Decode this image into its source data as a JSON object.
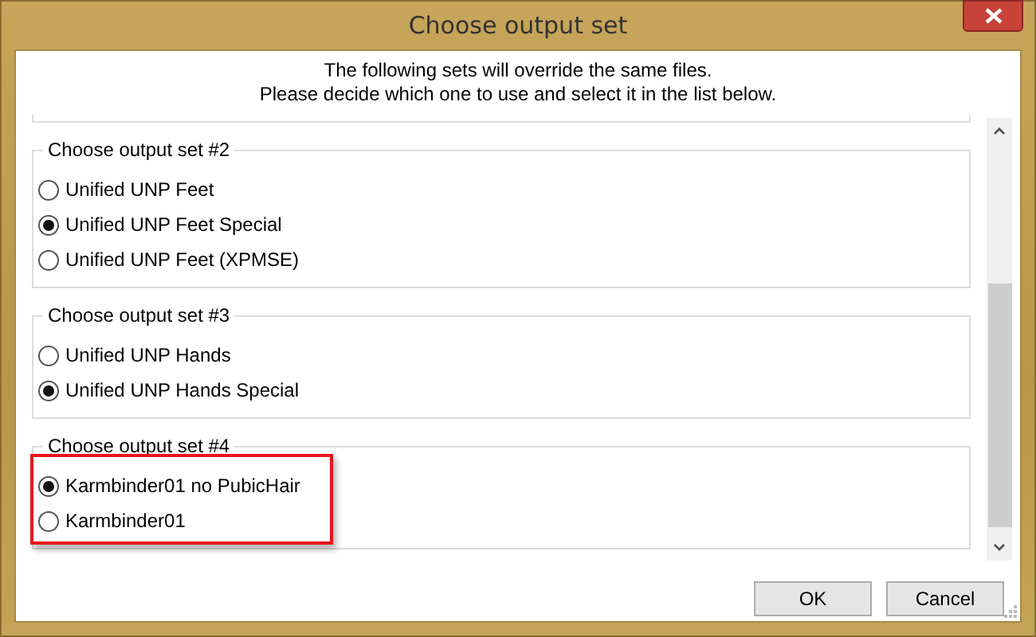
{
  "window": {
    "title": "Choose output set"
  },
  "message": [
    "The following sets will override the same files.",
    "Please decide which one to use and select it in the list below."
  ],
  "groups": [
    {
      "title": "Choose output set #2",
      "highlighted": false,
      "options": [
        {
          "label": "Unified UNP Feet",
          "selected": false
        },
        {
          "label": "Unified UNP Feet Special",
          "selected": true
        },
        {
          "label": "Unified UNP Feet (XPMSE)",
          "selected": false
        }
      ]
    },
    {
      "title": "Choose output set #3",
      "highlighted": false,
      "options": [
        {
          "label": "Unified UNP Hands",
          "selected": false
        },
        {
          "label": "Unified UNP Hands Special",
          "selected": true
        }
      ]
    },
    {
      "title": "Choose output set #4",
      "highlighted": true,
      "options": [
        {
          "label": "Karmbinder01 no PubicHair",
          "selected": true
        },
        {
          "label": "Karmbinder01",
          "selected": false
        }
      ]
    }
  ],
  "buttons": [
    "OK",
    "Cancel"
  ]
}
